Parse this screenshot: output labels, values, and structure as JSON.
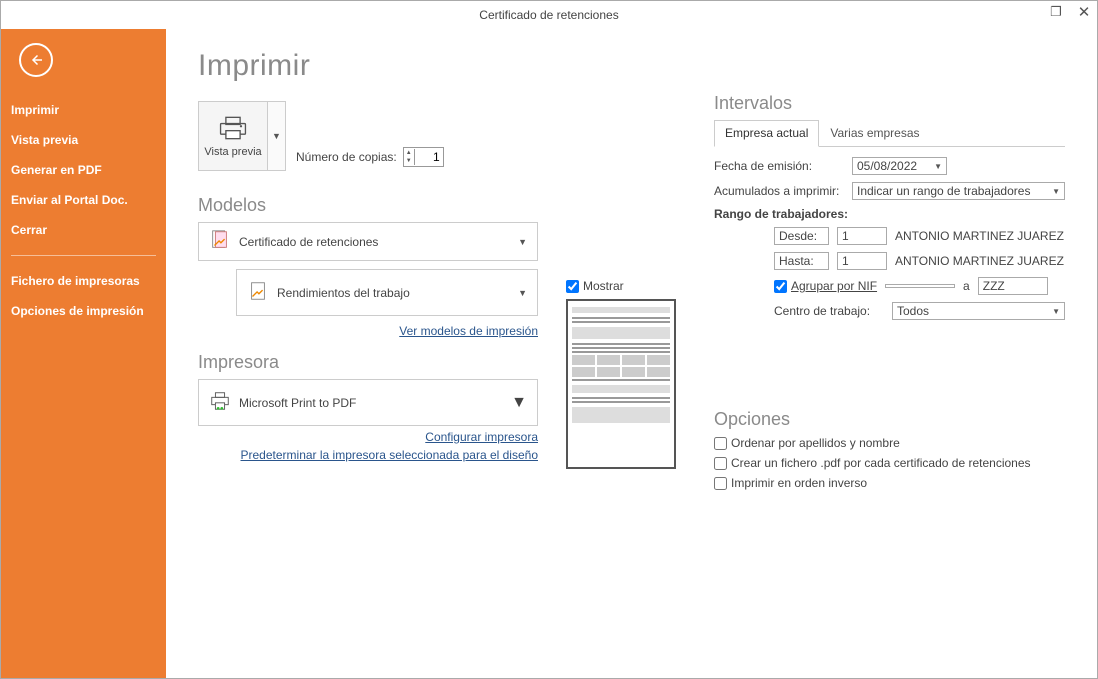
{
  "window": {
    "title": "Certificado de retenciones"
  },
  "sidebar": {
    "items": [
      "Imprimir",
      "Vista previa",
      "Generar en PDF",
      "Enviar al Portal Doc.",
      "Cerrar"
    ],
    "items2": [
      "Fichero de impresoras",
      "Opciones de impresión"
    ]
  },
  "main": {
    "heading": "Imprimir",
    "vista_previa": "Vista previa",
    "copies_label": "Número de copias:",
    "copies_value": "1",
    "modelos_heading": "Modelos",
    "modelo1": "Certificado de retenciones",
    "modelo2": "Rendimientos del trabajo",
    "link_modelos": "Ver modelos de impresión",
    "impresora_heading": "Impresora",
    "impresora_name": "Microsoft Print to PDF",
    "link_config": "Configurar impresora",
    "link_predet": "Predeterminar la impresora seleccionada para el diseño",
    "mostrar_label": "Mostrar"
  },
  "intervalos": {
    "heading": "Intervalos",
    "tab1": "Empresa actual",
    "tab2": "Varias empresas",
    "fecha_label": "Fecha de emisión:",
    "fecha_value": "05/08/2022",
    "acum_label": "Acumulados a imprimir:",
    "acum_value": "Indicar un rango de trabajadores",
    "rango_heading": "Rango de trabajadores:",
    "desde_label": "Desde:",
    "desde_value": "1",
    "desde_name": "ANTONIO MARTINEZ JUAREZ",
    "hasta_label": "Hasta:",
    "hasta_value": "1",
    "hasta_name": "ANTONIO MARTINEZ JUAREZ",
    "agrupar_label": "Agrupar por NIF",
    "a_sep": "a",
    "nif_from": "",
    "nif_to": "ZZZ",
    "centro_label": "Centro de trabajo:",
    "centro_value": "Todos"
  },
  "opciones": {
    "heading": "Opciones",
    "o1": "Ordenar por apellidos y nombre",
    "o2": "Crear un fichero .pdf por cada certificado de retenciones",
    "o3": "Imprimir en orden inverso"
  }
}
